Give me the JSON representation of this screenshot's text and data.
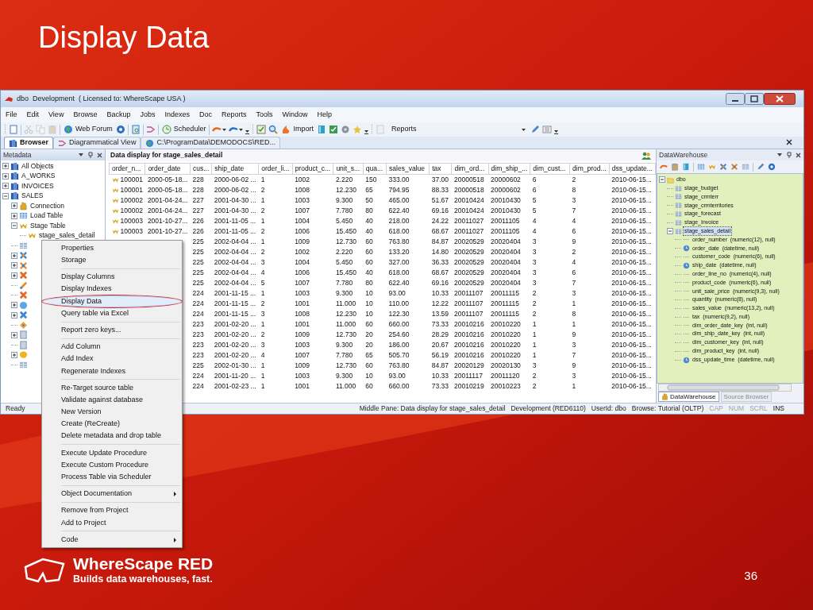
{
  "slide": {
    "title": "Display Data",
    "logo_name": "WhereScape RED",
    "tagline": "Builds data warehouses, fast.",
    "page_number": "36"
  },
  "window": {
    "title": "dbo  Development  ( Licensed to: WhereScape USA )"
  },
  "menu_bar": [
    "File",
    "Edit",
    "View",
    "Browse",
    "Backup",
    "Jobs",
    "Indexes",
    "Doc",
    "Reports",
    "Tools",
    "Window",
    "Help"
  ],
  "toolbar": [
    {
      "kind": "grip"
    },
    {
      "kind": "icon",
      "disabled": false
    },
    {
      "kind": "separator"
    },
    {
      "kind": "icon",
      "disabled": true
    },
    {
      "kind": "icon",
      "disabled": true
    },
    {
      "kind": "icon",
      "disabled": true
    },
    {
      "kind": "separator"
    },
    {
      "kind": "labeled",
      "label": "Web Forum"
    },
    {
      "kind": "icon",
      "disabled": false
    },
    {
      "kind": "separator"
    },
    {
      "kind": "icon",
      "disabled": false
    },
    {
      "kind": "separator"
    },
    {
      "kind": "icon",
      "disabled": false
    },
    {
      "kind": "separator"
    },
    {
      "kind": "labeled",
      "label": "Scheduler"
    },
    {
      "kind": "separator"
    },
    {
      "kind": "dropdown"
    },
    {
      "kind": "dropdown"
    },
    {
      "kind": "overflow"
    },
    {
      "kind": "grip"
    },
    {
      "kind": "icon",
      "disabled": false
    },
    {
      "kind": "icon",
      "disabled": false
    },
    {
      "kind": "labeled",
      "label": "Import"
    },
    {
      "kind": "icon",
      "disabled": false
    },
    {
      "kind": "icon",
      "disabled": false
    },
    {
      "kind": "icon",
      "disabled": false
    },
    {
      "kind": "icon",
      "disabled": false
    },
    {
      "kind": "overflow"
    },
    {
      "kind": "grip"
    },
    {
      "kind": "icon",
      "disabled": true
    },
    {
      "kind": "combo",
      "value": "Reports"
    },
    {
      "kind": "icon",
      "disabled": false
    },
    {
      "kind": "icon",
      "disabled": false
    },
    {
      "kind": "overflow"
    }
  ],
  "tabs": [
    {
      "label": "Browser",
      "selected": true
    },
    {
      "label": "Diagrammatical View",
      "selected": false
    },
    {
      "label": "C:\\ProgramData\\DEMODOCS\\RED...",
      "selected": false
    }
  ],
  "metadata": {
    "title": "Metadata",
    "tree": [
      {
        "label": "All Objects",
        "kind": "project",
        "expanded": false
      },
      {
        "label": "A_WORKS",
        "kind": "project",
        "expanded": false
      },
      {
        "label": "INVOICES",
        "kind": "project",
        "expanded": false
      },
      {
        "label": "SALES",
        "kind": "project",
        "expanded": true,
        "children": [
          {
            "label": "Connection",
            "kind": "connection",
            "expanded": false
          },
          {
            "label": "Load Table",
            "kind": "load",
            "expanded": false
          },
          {
            "label": "Stage Table",
            "kind": "stage",
            "expanded": true,
            "children": [
              {
                "label": "stage_sales_detail",
                "kind": "stage"
              }
            ]
          },
          {
            "kind": "grid"
          },
          {
            "kind": "cross",
            "expanded": false
          },
          {
            "kind": "cross2",
            "expanded": false
          },
          {
            "kind": "xmark",
            "expanded": false
          },
          {
            "kind": "link"
          },
          {
            "kind": "xmark"
          },
          {
            "kind": "globe",
            "expanded": false
          },
          {
            "kind": "xblue",
            "expanded": false
          },
          {
            "kind": "diamond"
          },
          {
            "kind": "page",
            "expanded": false
          },
          {
            "kind": "page"
          },
          {
            "kind": "drum",
            "expanded": false
          },
          {
            "kind": "grid"
          }
        ]
      }
    ]
  },
  "data_display": {
    "title": "Data display for stage_sales_detail",
    "columns": [
      "order_n...",
      "order_date",
      "cus...",
      "ship_date",
      "order_li...",
      "product_c...",
      "unit_s...",
      "qua...",
      "sales_value",
      "tax",
      "dim_ord...",
      "dim_ship_...",
      "dim_cust...",
      "dim_prod...",
      "dss_update..."
    ],
    "rows": [
      [
        "100001",
        "2000-05-18...",
        "228",
        "2000-06-02 ...",
        "1",
        "1002",
        "2.220",
        "150",
        "333.00",
        "37.00",
        "20000518",
        "20000602",
        "6",
        "2",
        "2010-06-15..."
      ],
      [
        "100001",
        "2000-05-18...",
        "228",
        "2000-06-02 ...",
        "2",
        "1008",
        "12.230",
        "65",
        "794.95",
        "88.33",
        "20000518",
        "20000602",
        "6",
        "8",
        "2010-06-15..."
      ],
      [
        "100002",
        "2001-04-24...",
        "227",
        "2001-04-30 ...",
        "1",
        "1003",
        "9.300",
        "50",
        "465.00",
        "51.67",
        "20010424",
        "20010430",
        "5",
        "3",
        "2010-06-15..."
      ],
      [
        "100002",
        "2001-04-24...",
        "227",
        "2001-04-30 ...",
        "2",
        "1007",
        "7.780",
        "80",
        "622.40",
        "69.16",
        "20010424",
        "20010430",
        "5",
        "7",
        "2010-06-15..."
      ],
      [
        "100003",
        "2001-10-27...",
        "226",
        "2001-11-05 ...",
        "1",
        "1004",
        "5.450",
        "40",
        "218.00",
        "24.22",
        "20011027",
        "20011105",
        "4",
        "4",
        "2010-06-15..."
      ],
      [
        "100003",
        "2001-10-27...",
        "226",
        "2001-11-05 ...",
        "2",
        "1006",
        "15.450",
        "40",
        "618.00",
        "68.67",
        "20011027",
        "20011105",
        "4",
        "6",
        "2010-06-15..."
      ],
      [
        "225",
        "2002-04-04 ...",
        "1",
        "1009",
        "12.730",
        "60",
        "763.80",
        "84.87",
        "20020529",
        "20020404",
        "3",
        "9",
        "2010-06-15..."
      ],
      [
        "225",
        "2002-04-04 ...",
        "2",
        "1002",
        "2.220",
        "60",
        "133.20",
        "14.80",
        "20020529",
        "20020404",
        "3",
        "2",
        "2010-06-15..."
      ],
      [
        "225",
        "2002-04-04 ...",
        "3",
        "1004",
        "5.450",
        "60",
        "327.00",
        "36.33",
        "20020529",
        "20020404",
        "3",
        "4",
        "2010-06-15..."
      ],
      [
        "225",
        "2002-04-04 ...",
        "4",
        "1006",
        "15.450",
        "40",
        "618.00",
        "68.67",
        "20020529",
        "20020404",
        "3",
        "6",
        "2010-06-15..."
      ],
      [
        "225",
        "2002-04-04 ...",
        "5",
        "1007",
        "7.780",
        "80",
        "622.40",
        "69.16",
        "20020529",
        "20020404",
        "3",
        "7",
        "2010-06-15..."
      ],
      [
        "224",
        "2001-11-15 ...",
        "1",
        "1003",
        "9.300",
        "10",
        "93.00",
        "10.33",
        "20011107",
        "20011115",
        "2",
        "3",
        "2010-06-15..."
      ],
      [
        "224",
        "2001-11-15 ...",
        "2",
        "1001",
        "11.000",
        "10",
        "110.00",
        "12.22",
        "20011107",
        "20011115",
        "2",
        "1",
        "2010-06-15..."
      ],
      [
        "224",
        "2001-11-15 ...",
        "3",
        "1008",
        "12.230",
        "10",
        "122.30",
        "13.59",
        "20011107",
        "20011115",
        "2",
        "8",
        "2010-06-15..."
      ],
      [
        "223",
        "2001-02-20 ...",
        "1",
        "1001",
        "11.000",
        "60",
        "660.00",
        "73.33",
        "20010216",
        "20010220",
        "1",
        "1",
        "2010-06-15..."
      ],
      [
        "223",
        "2001-02-20 ...",
        "2",
        "1009",
        "12.730",
        "20",
        "254.60",
        "28.29",
        "20010216",
        "20010220",
        "1",
        "9",
        "2010-06-15..."
      ],
      [
        "223",
        "2001-02-20 ...",
        "3",
        "1003",
        "9.300",
        "20",
        "186.00",
        "20.67",
        "20010216",
        "20010220",
        "1",
        "3",
        "2010-06-15..."
      ],
      [
        "223",
        "2001-02-20 ...",
        "4",
        "1007",
        "7.780",
        "65",
        "505.70",
        "56.19",
        "20010216",
        "20010220",
        "1",
        "7",
        "2010-06-15..."
      ],
      [
        "225",
        "2002-01-30 ...",
        "1",
        "1009",
        "12.730",
        "60",
        "763.80",
        "84.87",
        "20020129",
        "20020130",
        "3",
        "9",
        "2010-06-15..."
      ],
      [
        "224",
        "2001-11-20 ...",
        "1",
        "1003",
        "9.300",
        "10",
        "93.00",
        "10.33",
        "20011117",
        "20011120",
        "2",
        "3",
        "2010-06-15..."
      ],
      [
        "224",
        "2001-02-23 ...",
        "1",
        "1001",
        "11.000",
        "60",
        "660.00",
        "73.33",
        "20010219",
        "20010223",
        "2",
        "1",
        "2010-06-15..."
      ]
    ]
  },
  "datawarehouse": {
    "title": "DataWarehouse",
    "tree": [
      {
        "label": "dbo",
        "kind": "folder",
        "expanded": true,
        "children": [
          {
            "label": "stage_budget",
            "kind": "table",
            "selected": false
          },
          {
            "label": "stage_crmterr",
            "kind": "table",
            "selected": false
          },
          {
            "label": "stage_crmterritories",
            "kind": "table",
            "selected": false
          },
          {
            "label": "stage_forecast",
            "kind": "table",
            "selected": false
          },
          {
            "label": "stage_Invoice",
            "kind": "table",
            "selected": false
          },
          {
            "label": "stage_sales_detail",
            "kind": "table",
            "selected": true,
            "expanded": true,
            "children": [
              {
                "label": "order_number  (numeric(12), null)",
                "kind": "number"
              },
              {
                "label": "order_date  (datetime, null)",
                "kind": "datetime"
              },
              {
                "label": "customer_code  (numeric(6), null)",
                "kind": "number"
              },
              {
                "label": "ship_date  (datetime, null)",
                "kind": "datetime"
              },
              {
                "label": "order_line_no  (numeric(4), null)",
                "kind": "number"
              },
              {
                "label": "product_code  (numeric(6), null)",
                "kind": "number"
              },
              {
                "label": "unit_sale_price  (numeric(9,3), null)",
                "kind": "number"
              },
              {
                "label": "quantity  (numeric(8), null)",
                "kind": "number"
              },
              {
                "label": "sales_value  (numeric(13,2), null)",
                "kind": "number"
              },
              {
                "label": "tax  (numeric(9,2), null)",
                "kind": "number"
              },
              {
                "label": "dim_order_date_key  (int, null)",
                "kind": "number"
              },
              {
                "label": "dim_ship_date_key  (int, null)",
                "kind": "number"
              },
              {
                "label": "dim_customer_key  (int, null)",
                "kind": "number"
              },
              {
                "label": "dim_product_key  (int, null)",
                "kind": "number"
              },
              {
                "label": "dss_update_time  (datetime, null)",
                "kind": "datetime"
              }
            ]
          }
        ]
      }
    ],
    "tabs": [
      {
        "label": "DataWarehouse",
        "selected": true
      },
      {
        "label": "Source Browser",
        "selected": false
      }
    ]
  },
  "status_bar": {
    "left": "Ready",
    "segments": [
      "Middle Pane: Data display for stage_sales_detail",
      "Development (RED6110)",
      "UserId: dbo",
      "Browse: Tutorial (OLTP)"
    ],
    "indicators": [
      {
        "label": "CAP",
        "on": false
      },
      {
        "label": "NUM",
        "on": false
      },
      {
        "label": "SCRL",
        "on": false
      },
      {
        "label": "INS",
        "on": true
      }
    ]
  },
  "context_menu": [
    [
      {
        "label": "Properties",
        "selected": false,
        "submenu": false,
        "circled": false
      },
      {
        "label": "Storage",
        "selected": false,
        "submenu": false,
        "circled": false
      }
    ],
    [
      {
        "label": "Display Columns",
        "selected": false,
        "submenu": false,
        "circled": false
      },
      {
        "label": "Display Indexes",
        "selected": false,
        "submenu": false,
        "circled": false
      },
      {
        "label": "Display Data",
        "selected": true,
        "submenu": false,
        "circled": true
      },
      {
        "label": "Query table via Excel",
        "selected": false,
        "submenu": false,
        "circled": false
      }
    ],
    [
      {
        "label": "Report zero keys...",
        "selected": false,
        "submenu": false,
        "circled": false
      }
    ],
    [
      {
        "label": "Add Column",
        "selected": false,
        "submenu": false,
        "circled": false
      },
      {
        "label": "Add Index",
        "selected": false,
        "submenu": false,
        "circled": false
      },
      {
        "label": "Regenerate Indexes",
        "selected": false,
        "submenu": false,
        "circled": false
      }
    ],
    [
      {
        "label": "Re-Target source table",
        "selected": false,
        "submenu": false,
        "circled": false
      },
      {
        "label": "Validate against database",
        "selected": false,
        "submenu": false,
        "circled": false
      },
      {
        "label": "New Version",
        "selected": false,
        "submenu": false,
        "circled": false
      },
      {
        "label": "Create (ReCreate)",
        "selected": false,
        "submenu": false,
        "circled": false
      },
      {
        "label": "Delete metadata and drop table",
        "selected": false,
        "submenu": false,
        "circled": false
      }
    ],
    [
      {
        "label": "Execute Update Procedure",
        "selected": false,
        "submenu": false,
        "circled": false
      },
      {
        "label": "Execute Custom Procedure",
        "selected": false,
        "submenu": false,
        "circled": false
      },
      {
        "label": "Process Table via Scheduler",
        "selected": false,
        "submenu": false,
        "circled": false
      }
    ],
    [
      {
        "label": "Object Documentation",
        "selected": false,
        "submenu": true,
        "circled": false
      }
    ],
    [
      {
        "label": "Remove from Project",
        "selected": false,
        "submenu": false,
        "circled": false
      },
      {
        "label": "Add to Project",
        "selected": false,
        "submenu": false,
        "circled": false
      }
    ],
    [
      {
        "label": "Code",
        "selected": false,
        "submenu": true,
        "circled": false
      }
    ]
  ]
}
